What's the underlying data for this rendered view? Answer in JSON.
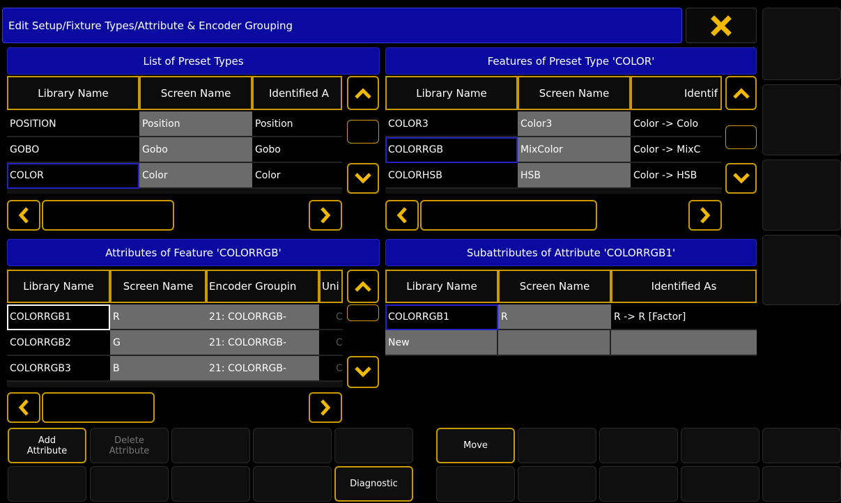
{
  "window": {
    "title": "Edit Setup/Fixture Types/Attribute & Encoder Grouping",
    "close_icon": "close-x-icon"
  },
  "colors": {
    "accent": "#c89a00",
    "title_blue": "#0a0aa0",
    "grey_cell": "#6b6b6b",
    "selection_blue": "#2222c8"
  },
  "preset_types": {
    "title": "List of Preset Types",
    "headers": [
      "Library Name",
      "Screen Name",
      "Identified A"
    ],
    "rows": [
      [
        "POSITION",
        "Position",
        "Position"
      ],
      [
        "GOBO",
        "Gobo",
        "Gobo"
      ],
      [
        "COLOR",
        "Color",
        "Color"
      ]
    ]
  },
  "features": {
    "title": "Features of Preset Type 'COLOR'",
    "headers": [
      "Library Name",
      "Screen Name",
      "Identif"
    ],
    "rows": [
      [
        "COLOR3",
        "Color3",
        "Color -> Colo"
      ],
      [
        "COLORRGB",
        "MixColor",
        "Color -> MixC"
      ],
      [
        "COLORHSB",
        "HSB",
        "Color -> HSB"
      ]
    ]
  },
  "attributes": {
    "title": "Attributes of Feature 'COLORRGB'",
    "headers": [
      "Library Name",
      "Screen Name",
      "Encoder Groupin",
      "Uni"
    ],
    "rows": [
      [
        "COLORRGB1",
        "R",
        "21: COLORRGB-",
        "C"
      ],
      [
        "COLORRGB2",
        "G",
        "21: COLORRGB-",
        "C"
      ],
      [
        "COLORRGB3",
        "B",
        "21: COLORRGB-",
        "C"
      ]
    ]
  },
  "subattributes": {
    "title": "Subattributes of Attribute 'COLORRGB1'",
    "headers": [
      "Library Name",
      "Screen Name",
      "Identified As"
    ],
    "rows": [
      [
        "COLORRGB1",
        "R",
        "R -> R [Factor]"
      ],
      [
        "New",
        "",
        ""
      ]
    ]
  },
  "buttons": {
    "add_attribute": [
      "Add",
      "Attribute"
    ],
    "delete_attribute": [
      "Delete",
      "Attribute"
    ],
    "move": "Move",
    "diagnostic": "Diagnostic"
  }
}
